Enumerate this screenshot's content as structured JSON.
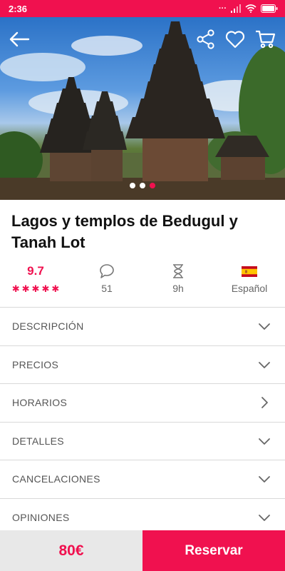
{
  "status_bar": {
    "time": "2:36",
    "battery_icon": "battery-icon",
    "wifi_icon": "wifi-icon",
    "signal_icon": "signal-icon"
  },
  "header": {
    "back_icon": "arrow-left-icon",
    "share_icon": "share-icon",
    "favorite_icon": "heart-icon",
    "cart_icon": "cart-icon"
  },
  "carousel": {
    "total": 3,
    "active": 3
  },
  "title": "Lagos y templos de Bedugul y Tanah Lot",
  "stats": {
    "rating": "9.7",
    "stars": 5,
    "reviews_count": "51",
    "duration": "9h",
    "language": "Español"
  },
  "sections": [
    {
      "label": "DESCRIPCIÓN",
      "icon": "chevron-down-icon"
    },
    {
      "label": "PRECIOS",
      "icon": "chevron-down-icon"
    },
    {
      "label": "HORARIOS",
      "icon": "chevron-right-icon"
    },
    {
      "label": "DETALLES",
      "icon": "chevron-down-icon"
    },
    {
      "label": "CANCELACIONES",
      "icon": "chevron-down-icon"
    },
    {
      "label": "OPINIONES",
      "icon": "chevron-down-icon"
    }
  ],
  "bottom": {
    "price": "80€",
    "reserve_label": "Reservar"
  },
  "colors": {
    "accent": "#f0114f",
    "text": "#111111",
    "muted": "#666666"
  }
}
